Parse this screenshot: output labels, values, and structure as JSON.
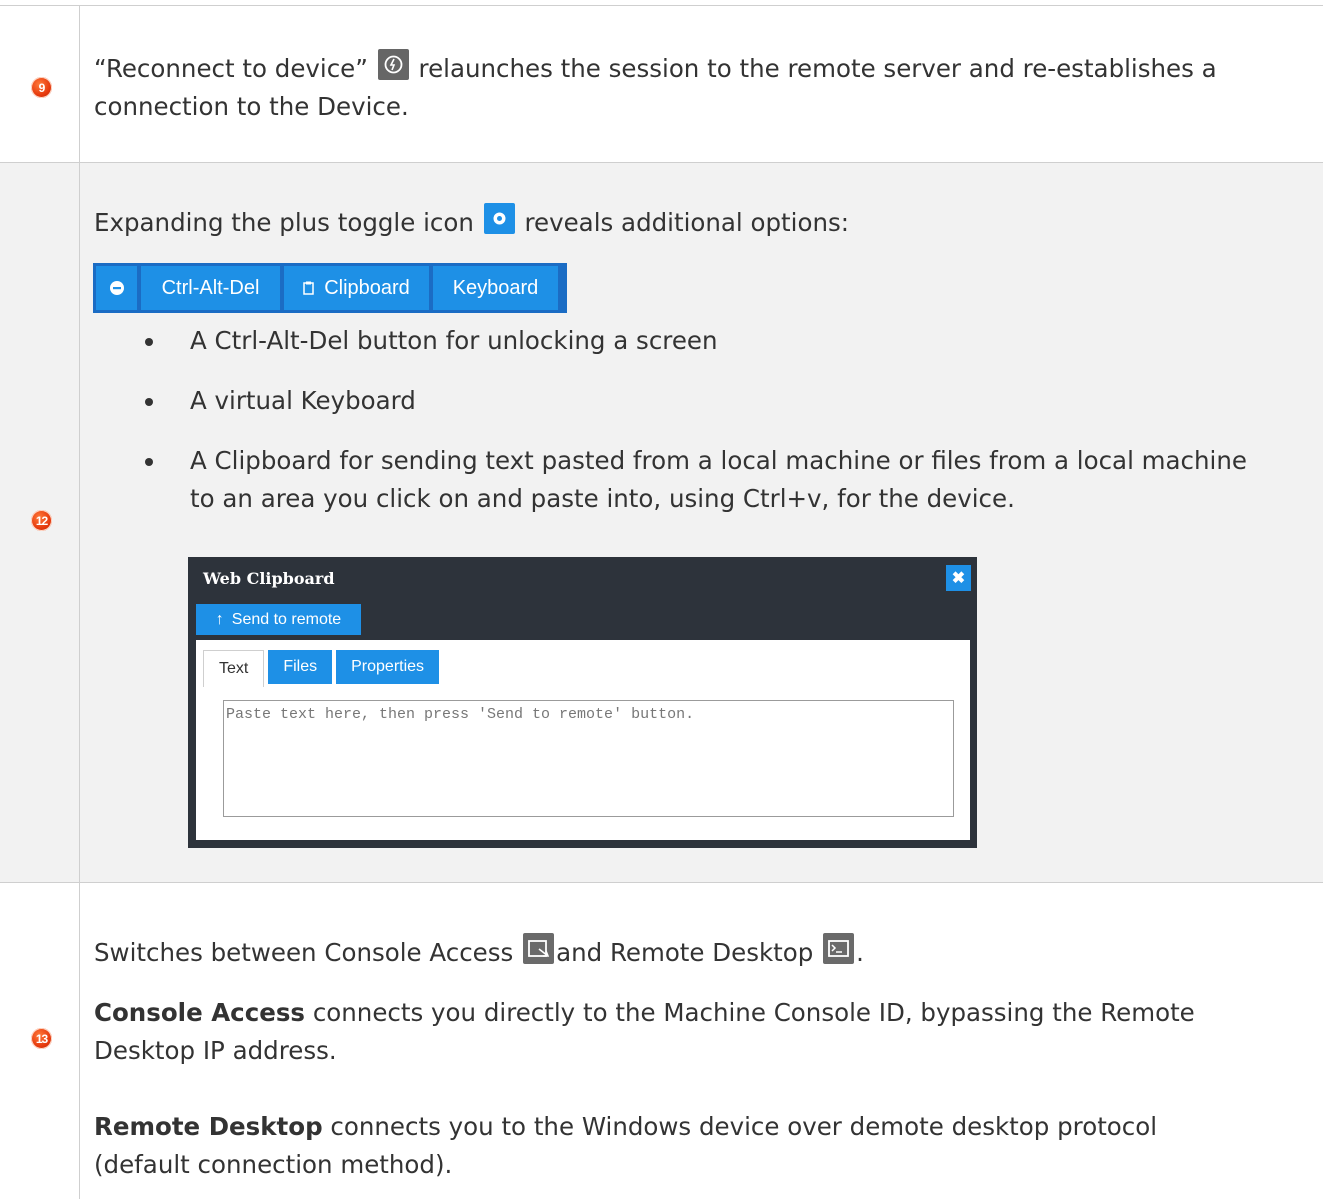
{
  "colors": {
    "accent": "#1e90e6",
    "badge": "#e5380c",
    "row_alt": "#f2f2f2",
    "dark_panel": "#2d333b"
  },
  "rows": [
    {
      "badge": "9",
      "pre": "“Reconnect to device”",
      "icon": "reconnect-icon",
      "post_line1": "relaunches the session to the remote server and re-establishes a",
      "line2": "connection to the Device."
    },
    {
      "badge": "12",
      "intro_pre": "Expanding the plus toggle icon",
      "icon": "plus-toggle-icon",
      "intro_post": "reveals additional options:",
      "toolbar": {
        "minus_icon": "minus-circle-icon",
        "ctrl_alt_del": "Ctrl-Alt-Del",
        "clipboard_icon": "clipboard-icon",
        "clipboard": "Clipboard",
        "keyboard": "Keyboard"
      },
      "bullets": [
        "A Ctrl-Alt-Del button for unlocking a screen",
        "A virtual Keyboard",
        "A Clipboard for sending text pasted from a local machine or files from a local machine",
        "to an area you click on and paste into, using Ctrl+v, for the device."
      ],
      "web_clipboard": {
        "title": "Web Clipboard",
        "close_icon": "close-icon",
        "send_button": "Send to remote",
        "tabs": [
          "Text",
          "Files",
          "Properties"
        ],
        "placeholder": "Paste text here, then press 'Send to remote' button."
      }
    },
    {
      "badge": "13",
      "switch_pre": "Switches between Console Access",
      "console_icon": "console-access-icon",
      "switch_mid": "and Remote Desktop",
      "rd_icon": "remote-desktop-icon",
      "switch_end": ".",
      "console_bold": "Console Access",
      "console_rest_line1": "connects you directly to the Machine Console ID, bypassing the Remote",
      "console_line2": "Desktop IP address.",
      "rd_bold": "Remote Desktop",
      "rd_rest_line1": "connects you to the Windows device over demote desktop protocol",
      "rd_line2": "(default connection method)."
    }
  ]
}
